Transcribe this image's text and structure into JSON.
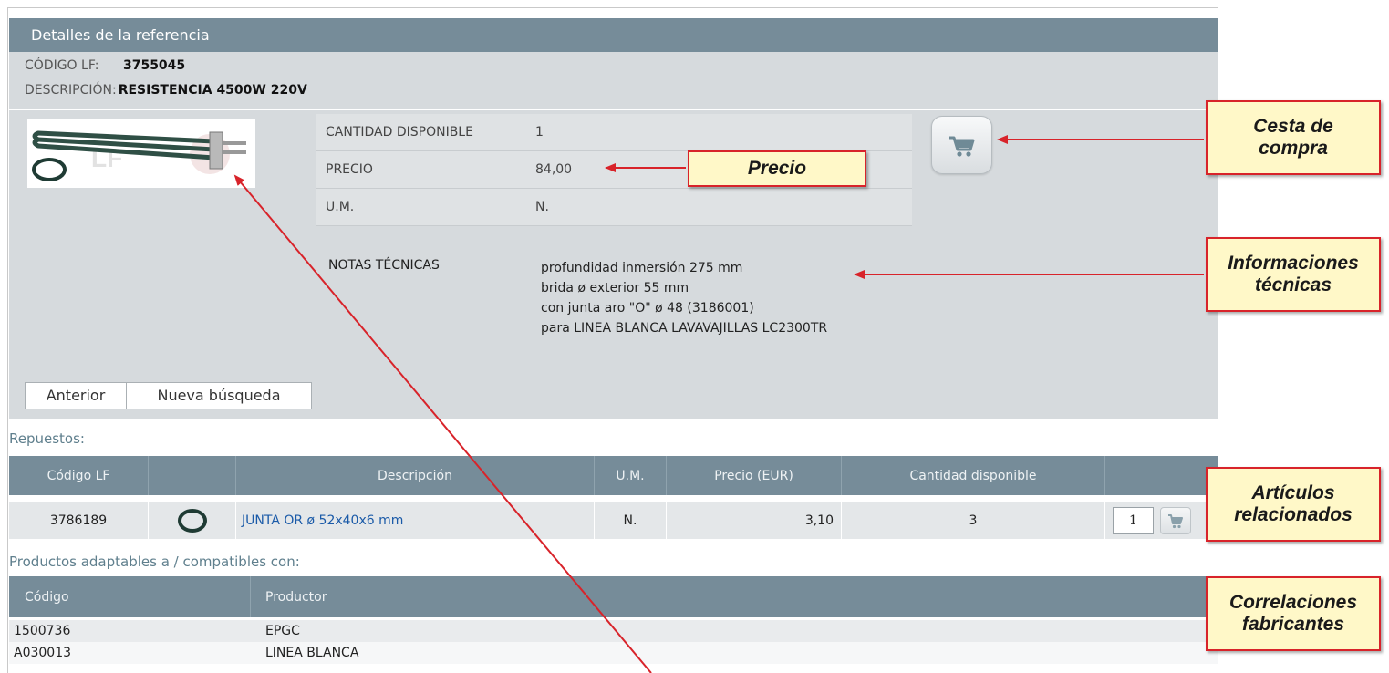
{
  "header": {
    "title": "Detalles de la referencia"
  },
  "reference": {
    "code_label": "CÓDIGO LF:",
    "code_value": "3755045",
    "desc_label": "DESCRIPCIÓN:",
    "desc_value": "RESISTENCIA 4500W 220V"
  },
  "details": {
    "qty_label": "CANTIDAD DISPONIBLE",
    "qty_value": "1",
    "price_label": "PRECIO",
    "price_value": "84,00",
    "um_label": "U.M.",
    "um_value": "N."
  },
  "notes": {
    "label": "NOTAS TÉCNICAS",
    "lines": [
      "profundidad inmersión 275 mm",
      "brida ø exterior 55 mm",
      "con junta aro \"O\" ø 48 (3186001)",
      "para LINEA BLANCA LAVAVAJILLAS LC2300TR"
    ]
  },
  "nav": {
    "prev_label": "Anterior",
    "new_search_label": "Nueva búsqueda"
  },
  "spares": {
    "title": "Repuestos:",
    "headers": [
      "Código LF",
      "",
      "Descripción",
      "U.M.",
      "Precio (EUR)",
      "Cantidad disponible",
      ""
    ],
    "rows": [
      {
        "code": "3786189",
        "description": "JUNTA OR ø 52x40x6 mm",
        "um": "N.",
        "price": "3,10",
        "available": "3",
        "qty_input": "1"
      }
    ]
  },
  "compatible": {
    "title": "Productos adaptables a / compatibles con:",
    "headers": [
      "Código",
      "Productor"
    ],
    "rows": [
      {
        "code": "1500736",
        "producer": "EPGC"
      },
      {
        "code": "A030013",
        "producer": "LINEA BLANCA"
      }
    ]
  },
  "callouts": {
    "precio": "Precio",
    "cesta_line1": "Cesta de",
    "cesta_line2": "compra",
    "info_line1": "Informaciones",
    "info_line2": "técnicas",
    "art_line1": "Artículos",
    "art_line2": "relacionados",
    "corr_line1": "Correlaciones",
    "corr_line2": "fabricantes"
  },
  "icons": {
    "cart": "shopping-cart-icon",
    "gasket": "o-ring-gasket-icon",
    "product": "heating-element-image"
  },
  "colors": {
    "header_bg": "#768c99",
    "panel_bg": "#d6dadd",
    "callout_bg": "#fff8c8",
    "callout_border": "#d8232a",
    "link": "#1a5aa8"
  }
}
